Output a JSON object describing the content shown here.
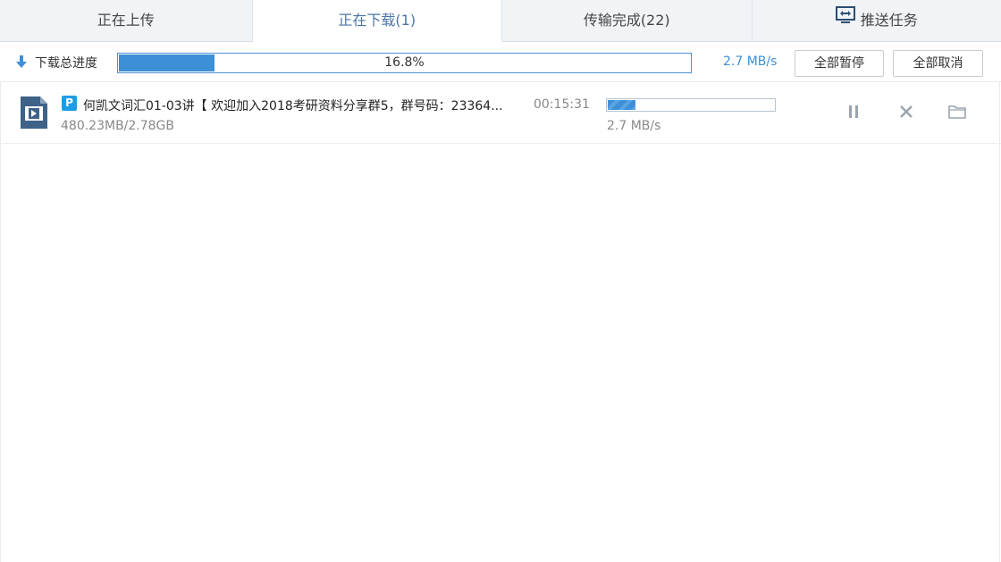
{
  "tabs": [
    {
      "label": "正在上传"
    },
    {
      "label": "正在下载(1)"
    },
    {
      "label": "传输完成(22)"
    },
    {
      "label": "推送任务"
    }
  ],
  "summary": {
    "label": "下载总进度",
    "percent_text": "16.8%",
    "progress_fraction": 0.168,
    "speed": "2.7 MB/s",
    "pause_all": "全部暂停",
    "cancel_all": "全部取消"
  },
  "task": {
    "badge": "P",
    "name": "何凯文词汇01-03讲【 欢迎加入2018考研资料分享群5，群号码：23364...",
    "remaining": "00:15:31",
    "size": "480.23MB/2.78GB",
    "progress_fraction": 0.168,
    "speed": "2.7 MB/s"
  },
  "icons": {
    "download_arrow": "download-arrow-icon",
    "push": "screen-push-icon",
    "file": "video-file-icon",
    "pause": "pause-icon",
    "close": "close-icon",
    "folder": "folder-icon"
  },
  "colors": {
    "accent": "#3d8fd6",
    "active_tab_text": "#4a76a8",
    "muted_text": "#888888",
    "badge": "#1e9ce6"
  }
}
